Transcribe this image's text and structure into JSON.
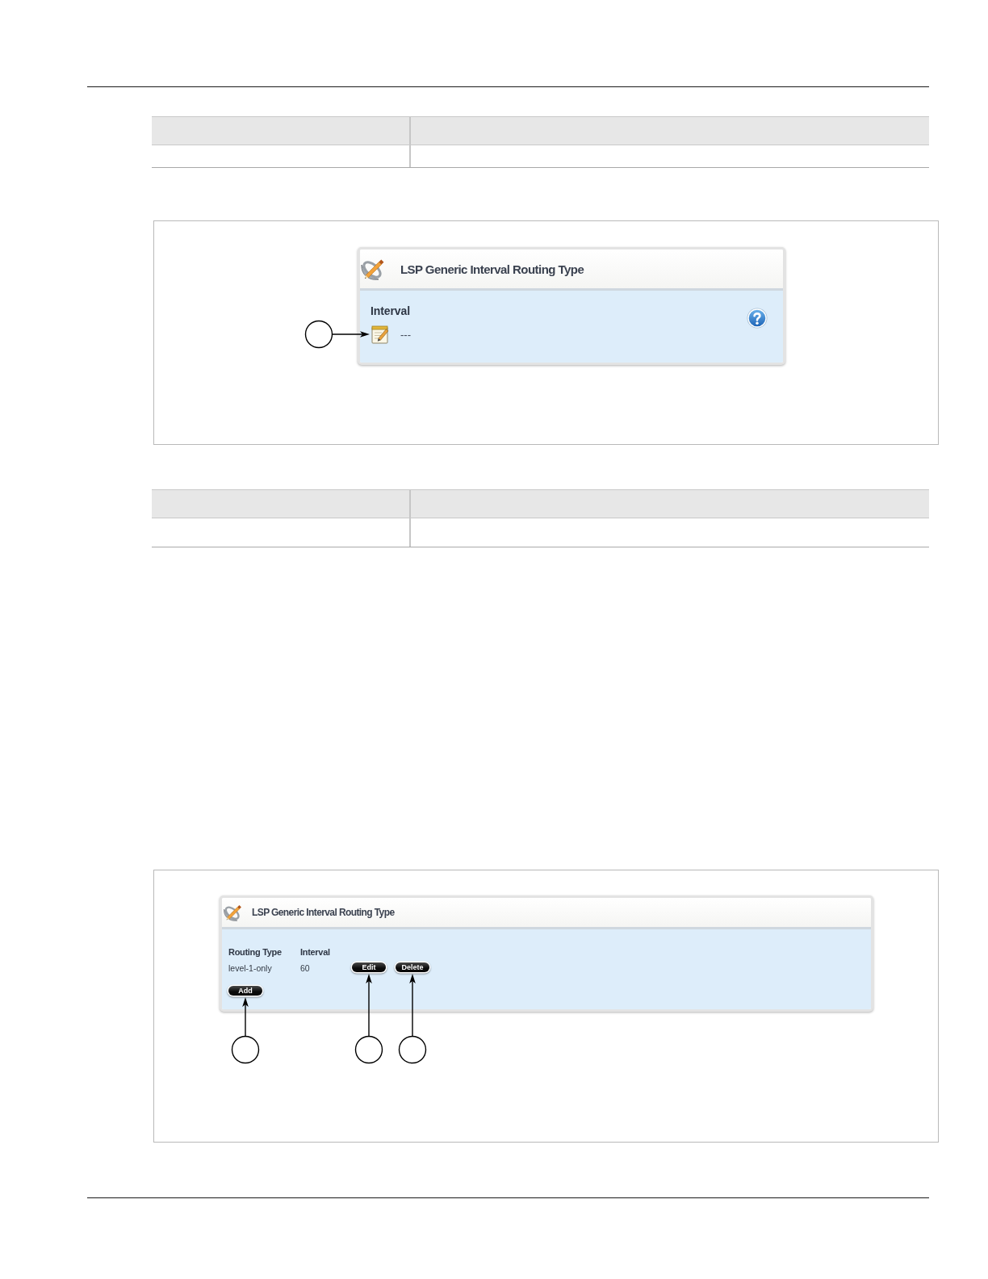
{
  "blocks": [
    {
      "kind": "table",
      "rows": [
        {
          "kind": "header"
        },
        {
          "kind": "body"
        }
      ]
    },
    {
      "kind": "figure",
      "panel": {
        "kind": "form",
        "title": "LSP Generic Interval Routing Type",
        "help": true,
        "fields": [
          {
            "label": "Interval",
            "value": "---",
            "callout": true
          }
        ]
      }
    },
    {
      "kind": "table",
      "rows": [
        {
          "kind": "header"
        },
        {
          "kind": "body"
        }
      ]
    },
    {
      "kind": "figure",
      "panel": {
        "kind": "list",
        "title": "LSP Generic Interval Routing Type",
        "columns": [
          "Routing Type",
          "Interval"
        ],
        "rows": [
          {
            "cells": [
              "level-1-only",
              "60"
            ],
            "actions": [
              {
                "label": "Edit",
                "callout": true
              },
              {
                "label": "Delete",
                "callout": true
              }
            ]
          }
        ],
        "buttons": [
          {
            "label": "Add",
            "callout": true
          }
        ]
      }
    }
  ]
}
